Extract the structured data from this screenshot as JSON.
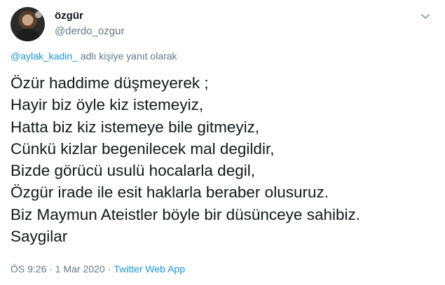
{
  "author": {
    "display_name": "özgür",
    "handle": "@derdo_ozgur"
  },
  "reply": {
    "mention": "@aylak_kadin_",
    "suffix": " adlı kişiye yanıt olarak"
  },
  "tweet_lines": [
    "Özür haddime düşmeyerek ;",
    "Hayir biz öyle kiz istemeyiz,",
    "Hatta biz kiz istemeye bile gitmeyiz,",
    "Cünkü kizlar begenilecek mal degildir,",
    "Bizde görücü usulü hocalarla degil,",
    "Özgür irade ile esit haklarla beraber olusuruz.",
    "Biz Maymun Ateistler böyle bir düsünceye sahibiz.",
    "Saygilar"
  ],
  "meta": {
    "timestamp": "ÖS 9:26 · 1 Mar 2020",
    "separator": "·",
    "source": "Twitter Web App"
  },
  "icons": {
    "menu": "chevron-down-icon"
  },
  "colors": {
    "text": "#14171a",
    "secondary": "#657786",
    "link": "#1b95e0"
  }
}
